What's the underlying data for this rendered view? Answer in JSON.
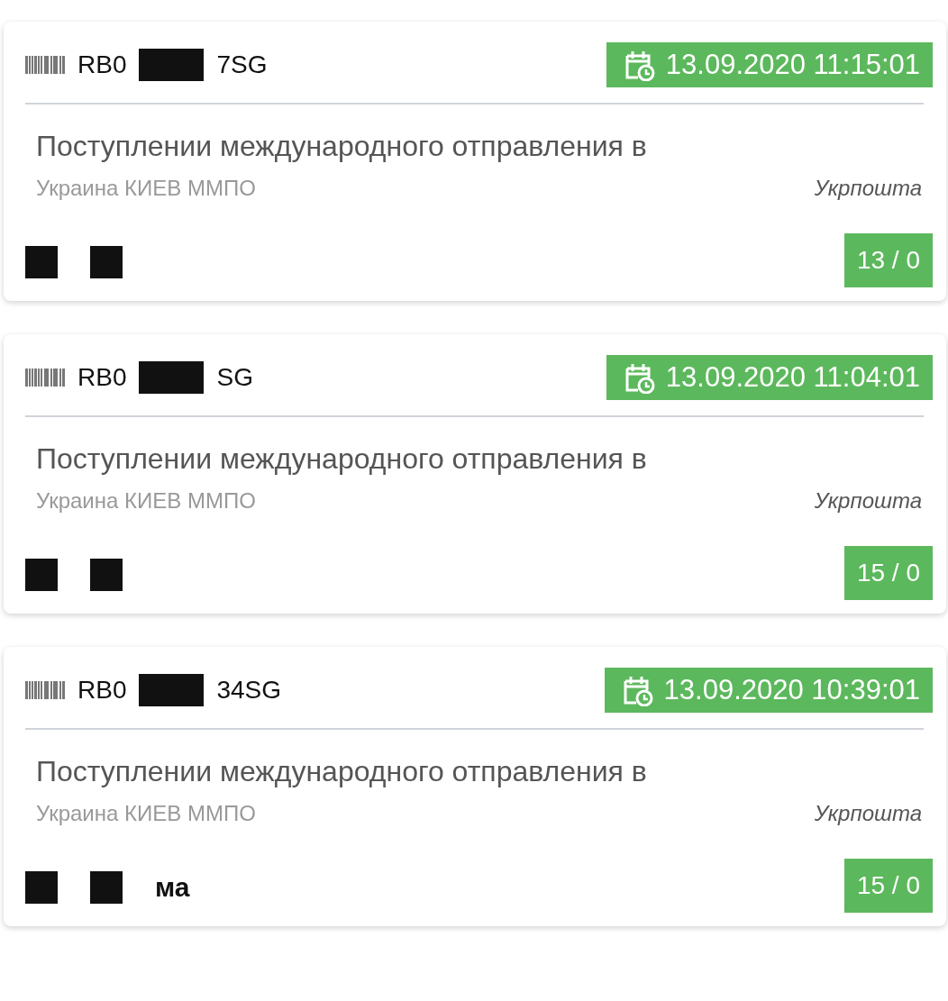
{
  "shipments": [
    {
      "tracking_start": "RB0",
      "tracking_end": "7SG",
      "date": "13.09.2020 11:15:01",
      "status": "Поступлении международного отправления в",
      "location": "Украина КИЕВ ММПО",
      "carrier": "Укрпошта",
      "count": "13 / 0"
    },
    {
      "tracking_start": "RB0",
      "tracking_end": "SG",
      "date": "13.09.2020 11:04:01",
      "status": "Поступлении международного отправления в",
      "location": "Украина КИЕВ ММПО",
      "carrier": "Укрпошта",
      "count": "15 / 0"
    },
    {
      "tracking_start": "RB0",
      "tracking_end": "34SG",
      "date": "13.09.2020 10:39:01",
      "status": "Поступлении международного отправления в",
      "location": "Украина КИЕВ ММПО",
      "carrier": "Укрпошта",
      "count": "15 / 0",
      "footer_text": "ма"
    }
  ]
}
